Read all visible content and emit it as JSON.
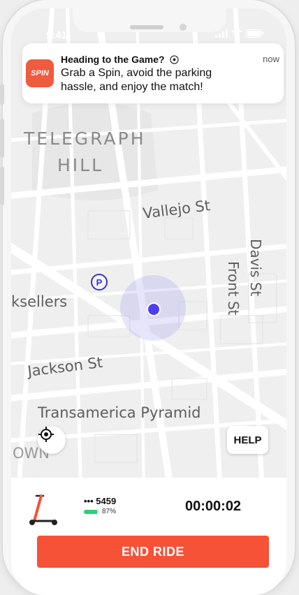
{
  "status_bar": {
    "time": "9:41"
  },
  "notification": {
    "app_icon_text": "SPIN",
    "title": "Heading to the Game?",
    "title_icon": "soccer-ball-icon",
    "time": "now",
    "body": "Grab a Spin, avoid the parking hassle, and enjoy the match!"
  },
  "map": {
    "labels": {
      "telegraph": "TELEGRAPH",
      "hill": "HILL",
      "vallejo": "Vallejo St",
      "davis": "Davis St",
      "front": "Front St",
      "ksellers": "ksellers",
      "jackson": "Jackson St",
      "transamerica": "Transamerica Pyramid",
      "town": "OWN"
    },
    "parking_marker": "P",
    "recenter_icon": "crosshair-icon",
    "help_label": "HELP"
  },
  "ride": {
    "vehicle_icon": "scooter-icon",
    "vehicle_id": "••• 5459",
    "battery_text": "87%",
    "battery_level": 0.87,
    "timer": "00:00:02",
    "end_ride_label": "END RIDE"
  },
  "colors": {
    "brand": "#f55238",
    "location": "#4b3ff0",
    "battery": "#2ecf78",
    "parking": "#3a34c8"
  }
}
